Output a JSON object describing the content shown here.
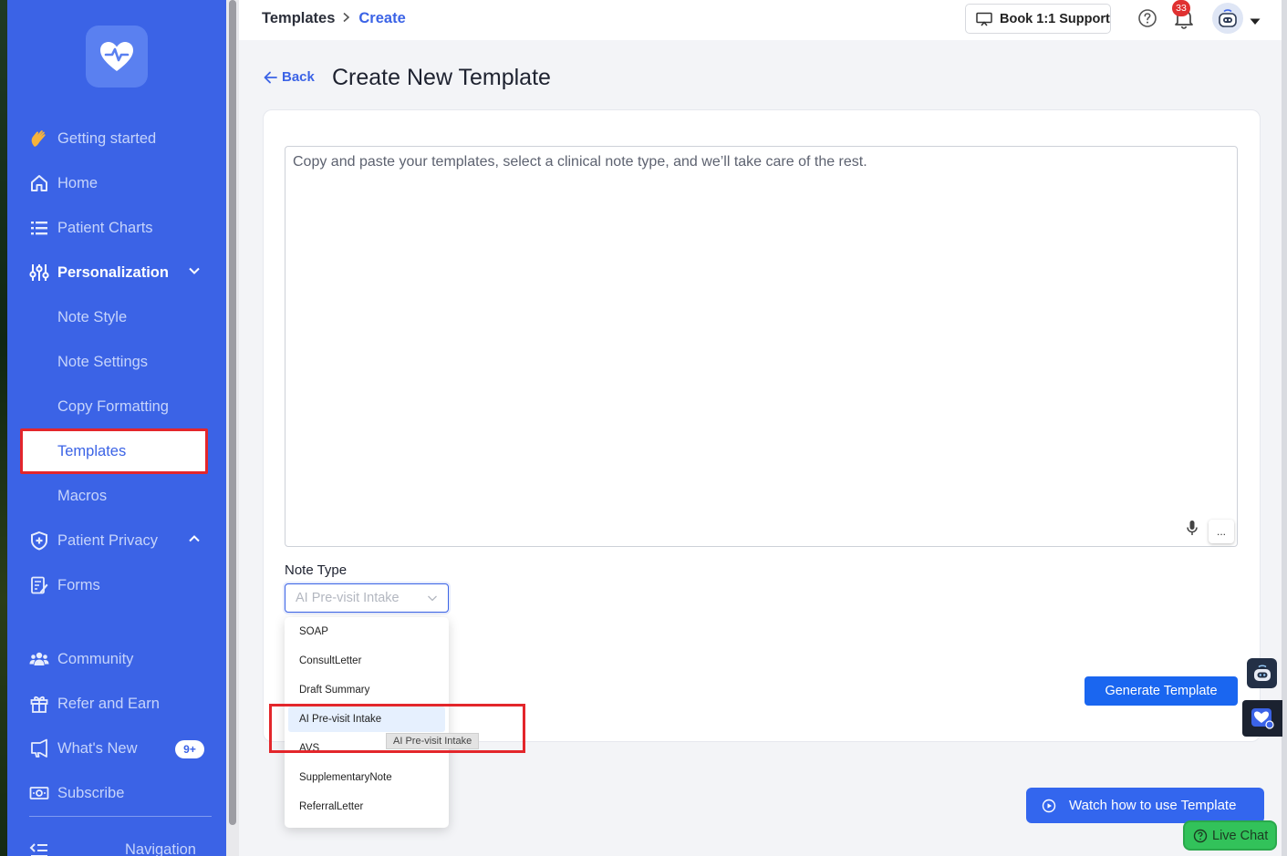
{
  "breadcrumb": {
    "parent": "Templates",
    "separator": ">",
    "current": "Create"
  },
  "topbar": {
    "support_label": "Book 1:1 Support",
    "notification_count": "33"
  },
  "sidebar": {
    "items": {
      "getting_started": "Getting started",
      "home": "Home",
      "patient_charts": "Patient Charts",
      "personalization": "Personalization",
      "note_style": "Note Style",
      "note_settings": "Note Settings",
      "copy_formatting": "Copy Formatting",
      "templates": "Templates",
      "macros": "Macros",
      "patient_privacy": "Patient Privacy",
      "forms": "Forms",
      "community": "Community",
      "refer_and_earn": "Refer and Earn",
      "whats_new": "What's New",
      "whats_new_badge": "9+",
      "subscribe": "Subscribe",
      "navigation": "Navigation"
    }
  },
  "page": {
    "back_label": "Back",
    "title": "Create New Template",
    "editor_placeholder": "Copy and paste your templates, select a clinical note type, and we’ll take care of the rest.",
    "more_button": "...",
    "note_type_label": "Note Type",
    "note_type_selected": "AI Pre-visit Intake",
    "note_type_options": [
      "SOAP",
      "ConsultLetter",
      "Draft Summary",
      "AI Pre-visit Intake",
      "AVS",
      "SupplementaryNote",
      "ReferralLetter"
    ],
    "tooltip": "AI Pre-visit Intake",
    "generate_button": "Generate Template",
    "watch_button": "Watch how to use Template",
    "live_chat": "Live Chat"
  },
  "colors": {
    "sidebar": "#3b63e6",
    "accent": "#1a66f0",
    "highlight": "#e3262b",
    "live_chat": "#32c25a"
  }
}
